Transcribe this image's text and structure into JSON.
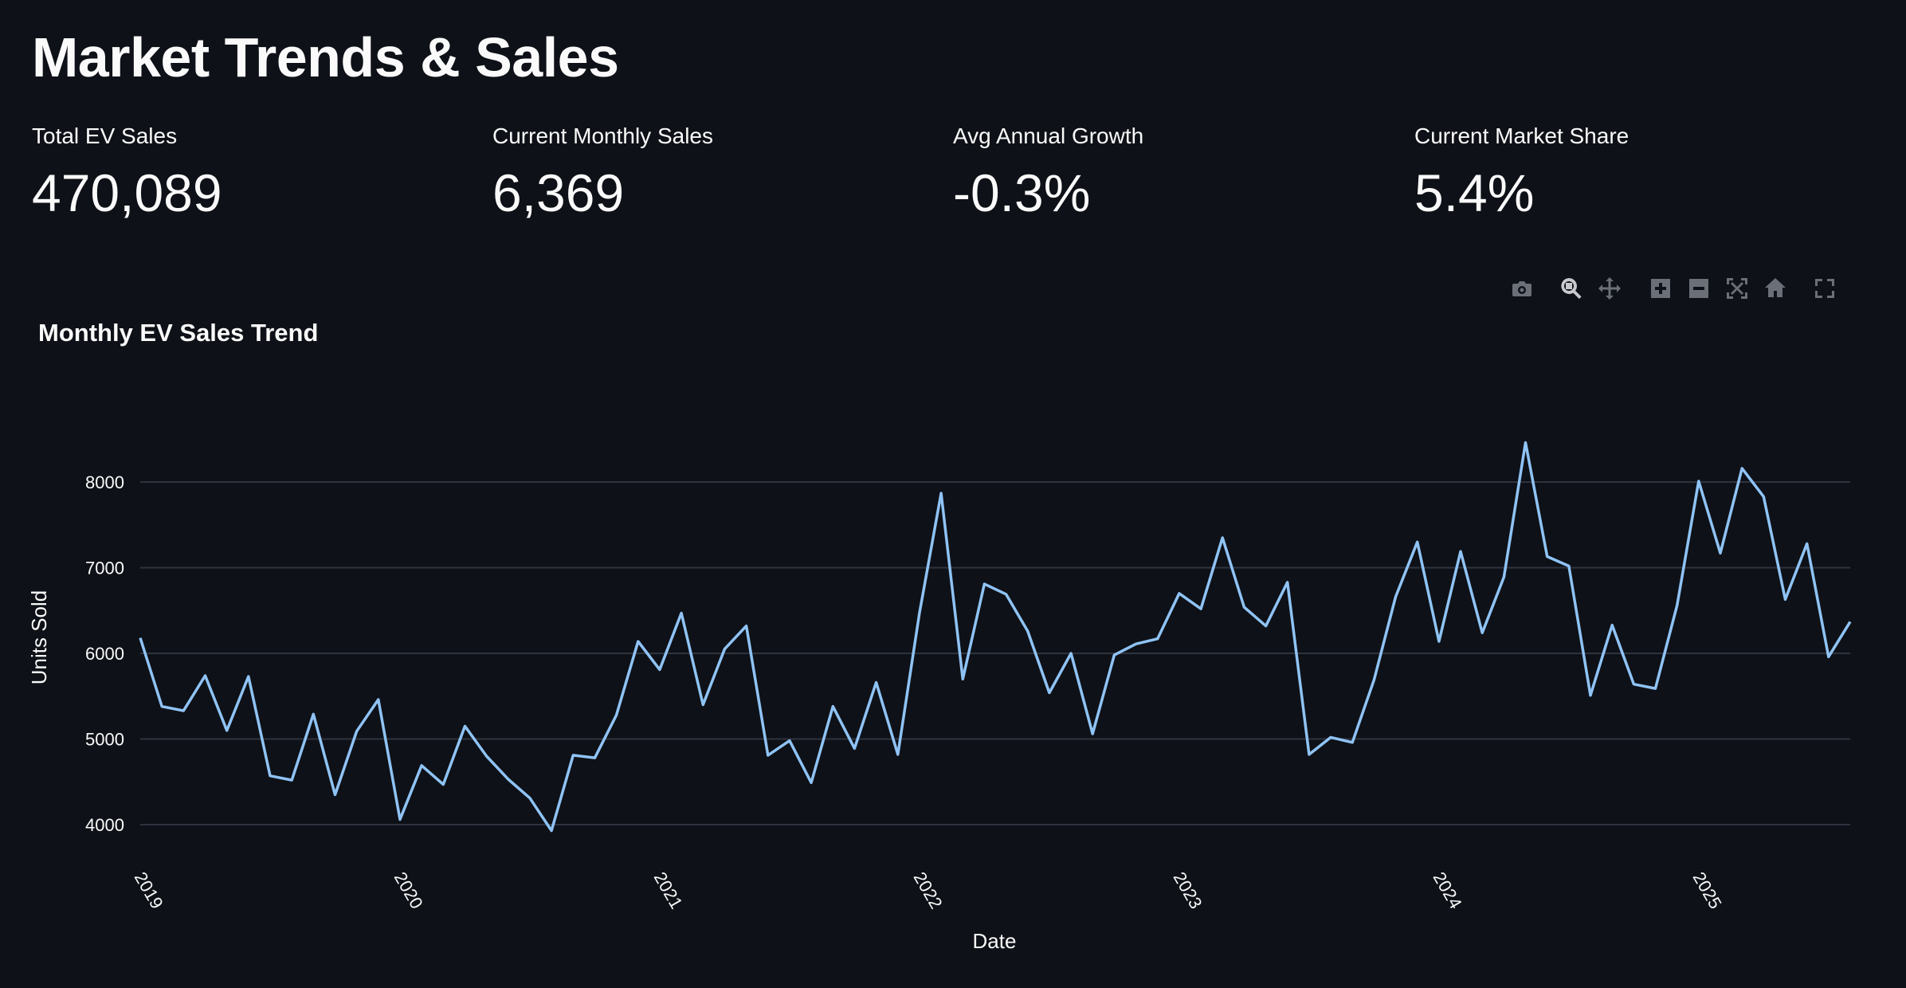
{
  "page": {
    "title": "Market Trends & Sales"
  },
  "metrics": [
    {
      "label": "Total EV Sales",
      "value": "470,089"
    },
    {
      "label": "Current Monthly Sales",
      "value": "6,369"
    },
    {
      "label": "Avg Annual Growth",
      "value": "-0.3%"
    },
    {
      "label": "Current Market Share",
      "value": "5.4%"
    }
  ],
  "modebar": {
    "icons": [
      "camera-icon",
      "zoom-icon",
      "pan-icon",
      "zoom-in-icon",
      "zoom-out-icon",
      "autoscale-icon",
      "reset-axes-icon",
      "fullscreen-icon"
    ]
  },
  "colors": {
    "background": "#0e1117",
    "line": "#8fc3f5",
    "grid": "#2e3340",
    "text": "#fafafa"
  },
  "chart_data": {
    "type": "line",
    "title": "Monthly EV Sales Trend",
    "xlabel": "Date",
    "ylabel": "Units Sold",
    "x_start": "2019-01",
    "x_ticks": [
      "2019",
      "2020",
      "2021",
      "2022",
      "2023",
      "2024",
      "2025"
    ],
    "y_ticks": [
      4000,
      5000,
      6000,
      7000,
      8000
    ],
    "ylim": [
      3500,
      9000
    ],
    "grid": true,
    "series": [
      {
        "values": [
          6180,
          5380,
          5330,
          5740,
          5100,
          5730,
          4570,
          4520,
          5290,
          4350,
          5090,
          5460,
          4060,
          4690,
          4470,
          5150,
          4800,
          4530,
          4310,
          3930,
          4810,
          4780,
          5280,
          6140,
          5810,
          6470,
          5400,
          6050,
          6320,
          4810,
          4980,
          4490,
          5380,
          4890,
          5660,
          4820,
          6470,
          7870,
          5700,
          6810,
          6690,
          6260,
          5540,
          6000,
          5060,
          5980,
          6110,
          6170,
          6700,
          6520,
          7350,
          6540,
          6320,
          6830,
          4820,
          5020,
          4960,
          5690,
          6660,
          7300,
          6140,
          7190,
          6240,
          6890,
          8460,
          7130,
          7020,
          5510,
          6330,
          5640,
          5590,
          6560,
          8010,
          7170,
          8160,
          7830,
          6630,
          7280,
          5960,
          6369
        ]
      }
    ]
  }
}
